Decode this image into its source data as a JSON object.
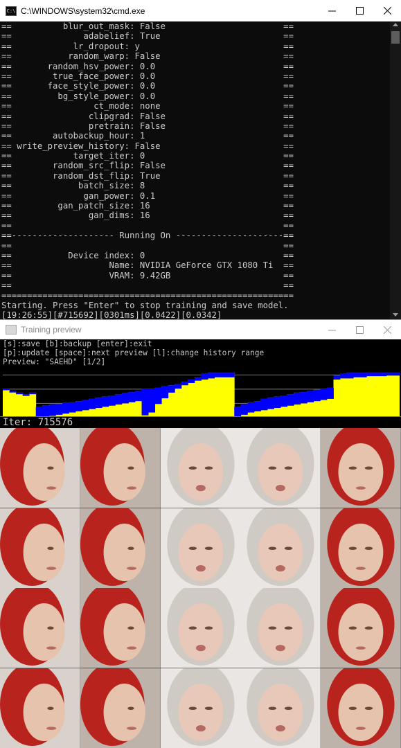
{
  "cmd_window": {
    "icon_label": "C:\\",
    "title": "C:\\WINDOWS\\system32\\cmd.exe",
    "lines": [
      "==          blur_out_mask: False                       ==",
      "==              adabelief: True                        ==",
      "==            lr_dropout: y                            ==",
      "==           random_warp: False                        ==",
      "==       random_hsv_power: 0.0                         ==",
      "==        true_face_power: 0.0                         ==",
      "==       face_style_power: 0.0                         ==",
      "==         bg_style_power: 0.0                         ==",
      "==                ct_mode: none                        ==",
      "==               clipgrad: False                       ==",
      "==               pretrain: False                       ==",
      "==        autobackup_hour: 1                           ==",
      "== write_preview_history: False                        ==",
      "==            target_iter: 0                           ==",
      "==        random_src_flip: False                       ==",
      "==        random_dst_flip: True                        ==",
      "==             batch_size: 8                           ==",
      "==              gan_power: 0.1                         ==",
      "==         gan_patch_size: 16                          ==",
      "==               gan_dims: 16                          ==",
      "==                                                     ==",
      "==-------------------- Running On ---------------------==",
      "==                                                     ==",
      "==           Device index: 0                           ==",
      "==                   Name: NVIDIA GeForce GTX 1080 Ti  ==",
      "==                   VRAM: 9.42GB                      ==",
      "==                                                     ==",
      "=========================================================",
      "Starting. Press \"Enter\" to stop training and save model.",
      "[19:26:55][#715692][0301ms][0.0422][0.0342]"
    ]
  },
  "preview_window": {
    "title": "Training preview",
    "help_lines": [
      "[s]:save [b]:backup [enter]:exit",
      "[p]:update [space]:next preview [l]:change history range",
      "Preview: \"SAEHD\" [1/2]"
    ],
    "iter_label": "Iter: 715576"
  },
  "loss_history": {
    "type": "area",
    "series": [
      {
        "color": "#ffff00",
        "values": [
          0.62,
          0.58,
          0.55,
          0.52,
          0.55,
          0.3,
          0.32,
          0.34,
          0.35,
          0.37,
          0.38,
          0.4,
          0.42,
          0.44,
          0.46,
          0.48,
          0.5,
          0.52,
          0.54,
          0.56,
          0.58,
          0.62,
          0.62,
          0.64,
          0.66,
          0.68,
          0.7,
          0.74,
          0.78,
          0.82,
          0.88,
          0.9,
          0.9,
          0.9,
          0.9,
          0.3,
          0.34,
          0.38,
          0.4,
          0.44,
          0.46,
          0.48,
          0.5,
          0.52,
          0.55,
          0.56,
          0.58,
          0.6,
          0.62,
          0.64,
          0.85,
          0.88,
          0.9,
          0.9,
          0.9,
          0.9,
          0.9,
          0.9,
          0.9,
          0.9
        ]
      },
      {
        "color": "#0000ff",
        "values": [
          0.62,
          0.58,
          0.55,
          0.52,
          0.55,
          0.1,
          0.12,
          0.14,
          0.16,
          0.18,
          0.2,
          0.22,
          0.24,
          0.26,
          0.28,
          0.3,
          0.32,
          0.34,
          0.36,
          0.38,
          0.4,
          0.15,
          0.2,
          0.35,
          0.45,
          0.55,
          0.62,
          0.68,
          0.72,
          0.76,
          0.78,
          0.8,
          0.82,
          0.82,
          0.82,
          0.12,
          0.16,
          0.2,
          0.22,
          0.24,
          0.26,
          0.28,
          0.3,
          0.32,
          0.34,
          0.36,
          0.38,
          0.4,
          0.42,
          0.44,
          0.78,
          0.8,
          0.8,
          0.82,
          0.82,
          0.84,
          0.84,
          0.84,
          0.85,
          0.85
        ]
      }
    ]
  },
  "preview_grid": {
    "columns": 5,
    "rows": [
      [
        "redhead-doll",
        "redhead-doll",
        "blonde-woman",
        "blonde-woman",
        "redhead-doll"
      ],
      [
        "redhead-doll",
        "redhead-doll",
        "blonde-woman",
        "blonde-woman",
        "redhead-doll"
      ],
      [
        "redhead-doll",
        "redhead-doll",
        "blonde-woman",
        "blonde-woman",
        "redhead-doll"
      ],
      [
        "redhead-doll",
        "redhead-doll",
        "blonde-woman",
        "blonde-woman",
        "redhead-doll"
      ]
    ]
  }
}
